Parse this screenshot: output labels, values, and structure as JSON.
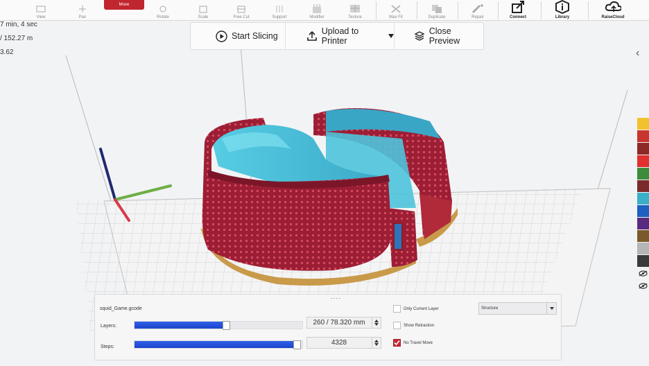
{
  "toolbar": {
    "tools": [
      {
        "id": "view",
        "label": "View",
        "icon": "view-icon"
      },
      {
        "id": "pan",
        "label": "Pan",
        "icon": "pan-icon"
      },
      {
        "id": "move",
        "label": "Move",
        "icon": "move-icon",
        "active": true
      },
      {
        "id": "rotate",
        "label": "Rotate",
        "icon": "rotate-icon"
      },
      {
        "id": "scale",
        "label": "Scale",
        "icon": "scale-icon"
      },
      {
        "id": "free_cut",
        "label": "Free Cut",
        "icon": "free-cut-icon"
      },
      {
        "id": "support",
        "label": "Support",
        "icon": "support-icon"
      },
      {
        "id": "modifier",
        "label": "Modifier",
        "icon": "modifier-icon"
      },
      {
        "id": "texture",
        "label": "Texture",
        "icon": "texture-icon"
      },
      {
        "id": "max_fit",
        "label": "Max Fit",
        "icon": "max-fit-icon"
      },
      {
        "id": "duplicate",
        "label": "Duplicate",
        "icon": "duplicate-icon"
      },
      {
        "id": "repair",
        "label": "Repair",
        "icon": "repair-icon"
      },
      {
        "id": "connect",
        "label": "Connect",
        "icon": "connect-icon"
      },
      {
        "id": "library",
        "label": "Library",
        "icon": "library-icon"
      },
      {
        "id": "raisecloud",
        "label": "RaiseCloud",
        "icon": "cloud-icon"
      }
    ]
  },
  "stats": {
    "time": "7 min, 4 sec",
    "filament": "/ 152.27 m",
    "cost": "3.62"
  },
  "actions": {
    "start_slicing": "Start Slicing",
    "upload": "Upload to Printer",
    "close_preview": "Close Preview"
  },
  "preview_panel": {
    "filename": "squid_Game.gcode",
    "layers_label": "Layers:",
    "layers_value": "260 / 78.320 mm",
    "layers_progress": 0.55,
    "steps_label": "Steps:",
    "steps_value": "4328",
    "steps_progress": 0.97,
    "only_current_layer": "Only Current Layer",
    "only_current_layer_checked": false,
    "show_retraction": "Show Retraction",
    "show_retraction_checked": false,
    "no_travel_move": "No Travel Move",
    "no_travel_move_checked": true,
    "view_mode": "Structure"
  },
  "palette": [
    "#f2c12e",
    "#c8352e",
    "#8e2a26",
    "#e03030",
    "#3c8c3c",
    "#7a2a2a",
    "#3ab0c8",
    "#1f5fbf",
    "#5a2a80",
    "#7a5a2a",
    "#b5b5b5",
    "#3a3a3a"
  ],
  "colors": {
    "accent": "#c0262d",
    "wall": "#a8233a",
    "infill": "#4ec3dc",
    "skirt": "#c89a4a",
    "slider_fill": "#2450de"
  }
}
